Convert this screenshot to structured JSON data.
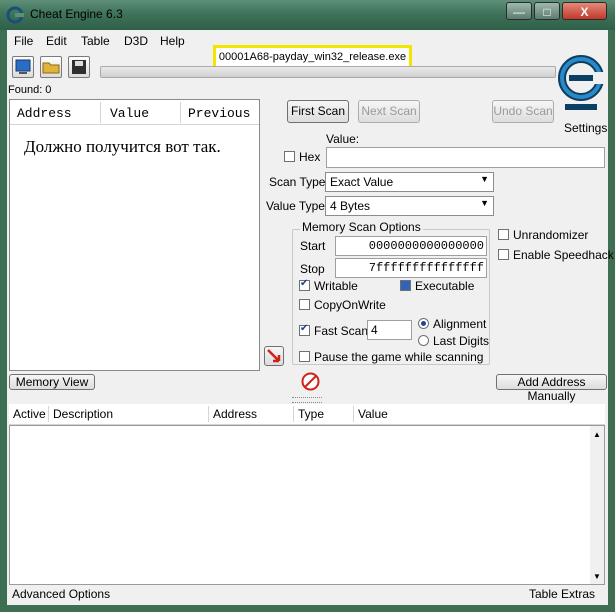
{
  "window": {
    "title": "Cheat Engine 6.3",
    "min": "—",
    "max": "□",
    "close": "X"
  },
  "menu": [
    "File",
    "Edit",
    "Table",
    "D3D",
    "Help"
  ],
  "process": "00001A68-payday_win32_release.exe",
  "found": "Found: 0",
  "settings": "Settings",
  "address_list": {
    "columns": [
      "Address",
      "Value",
      "Previous"
    ],
    "overlay_text": "Должно получится вот так."
  },
  "scan": {
    "first_scan": "First Scan",
    "next_scan": "Next Scan",
    "undo_scan": "Undo Scan",
    "value_label": "Value:",
    "hex_label": "Hex",
    "scan_type_label": "Scan Type",
    "scan_type_value": "Exact Value",
    "value_type_label": "Value Type",
    "value_type_value": "4 Bytes"
  },
  "memory_options": {
    "title": "Memory Scan Options",
    "start_label": "Start",
    "start_value": "0000000000000000",
    "stop_label": "Stop",
    "stop_value": "7fffffffffffffff",
    "writable": "Writable",
    "executable": "Executable",
    "copyonwrite": "CopyOnWrite",
    "fast_scan": "Fast Scan",
    "fast_scan_value": "4",
    "alignment": "Alignment",
    "last_digits": "Last Digits",
    "pause": "Pause the game while scanning"
  },
  "extras": {
    "unrandomizer": "Unrandomizer",
    "speedhack": "Enable Speedhack"
  },
  "memory_view": "Memory View",
  "add_address": "Add Address Manually",
  "table": {
    "columns": [
      "Active",
      "Description",
      "Address",
      "Type",
      "Value"
    ]
  },
  "status": {
    "left": "Advanced Options",
    "right": "Table Extras"
  }
}
